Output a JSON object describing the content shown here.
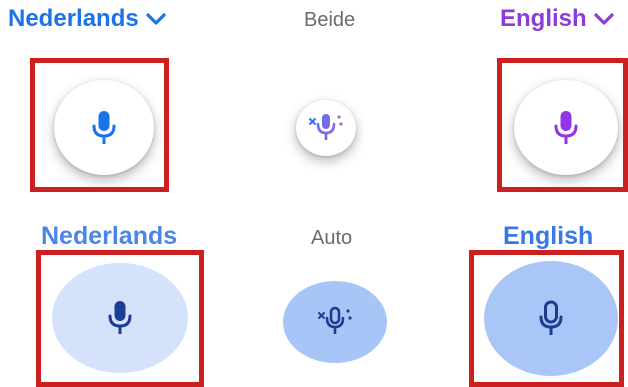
{
  "top_row": {
    "left_language": "Nederlands",
    "middle_label": "Beide",
    "right_language": "English"
  },
  "bottom_row": {
    "left_language": "Nederlands",
    "middle_label": "Auto",
    "right_language": "English"
  },
  "colors": {
    "blue_accent": "#1a73e8",
    "purple_accent": "#8e3cd9",
    "light_blue_fill": "#d4e3fb",
    "mid_blue_fill": "#a8c5f7",
    "highlight_box": "#cc2020"
  },
  "icons": {
    "language_dropdown": "chevron-down-icon",
    "microphone": "microphone-icon",
    "auto_microphone": "auto-detect-microphone-icon"
  }
}
